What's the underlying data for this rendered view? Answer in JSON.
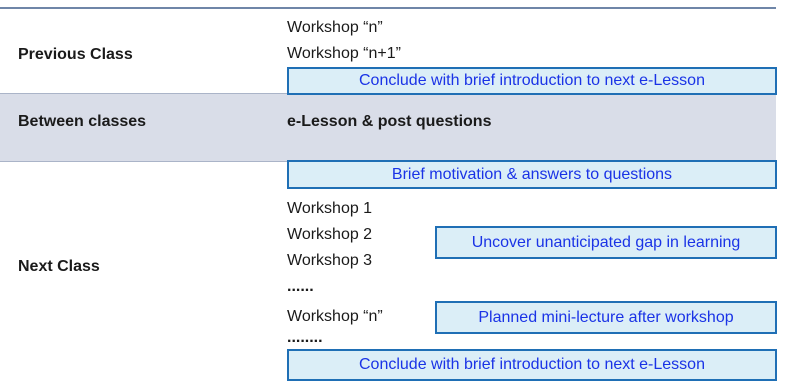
{
  "previous_class": {
    "label": "Previous Class",
    "items": [
      "Workshop “n”",
      "Workshop “n+1”"
    ],
    "conclude_box": "Conclude with brief introduction to next e-Lesson"
  },
  "between_classes": {
    "label": "Between classes",
    "activity": "e-Lesson & post questions"
  },
  "next_class": {
    "label": "Next Class",
    "motivation_box": "Brief motivation & answers to questions",
    "items": [
      "Workshop 1",
      "Workshop 2",
      "Workshop 3",
      "......",
      "Workshop “n”",
      "........"
    ],
    "gap_box": "Uncover unanticipated gap in learning",
    "mini_lecture_box": "Planned mini-lecture after workshop",
    "conclude_box": "Conclude with brief introduction to next e-Lesson"
  },
  "colors": {
    "band": "#d9dde8",
    "box_fill": "#dbeef7",
    "box_border": "#1f6fb5",
    "box_text": "#1a33e6"
  }
}
